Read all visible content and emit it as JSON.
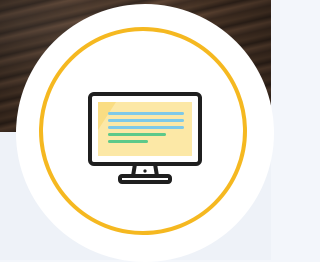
{
  "icon": {
    "name": "computer-monitor-icon",
    "ring_color": "#f5b820",
    "screen_color": "#fce8a6",
    "line_colors": [
      "#7ec9e8",
      "#7ec9e8",
      "#7ec9e8",
      "#5cc98a",
      "#5cc98a"
    ]
  }
}
